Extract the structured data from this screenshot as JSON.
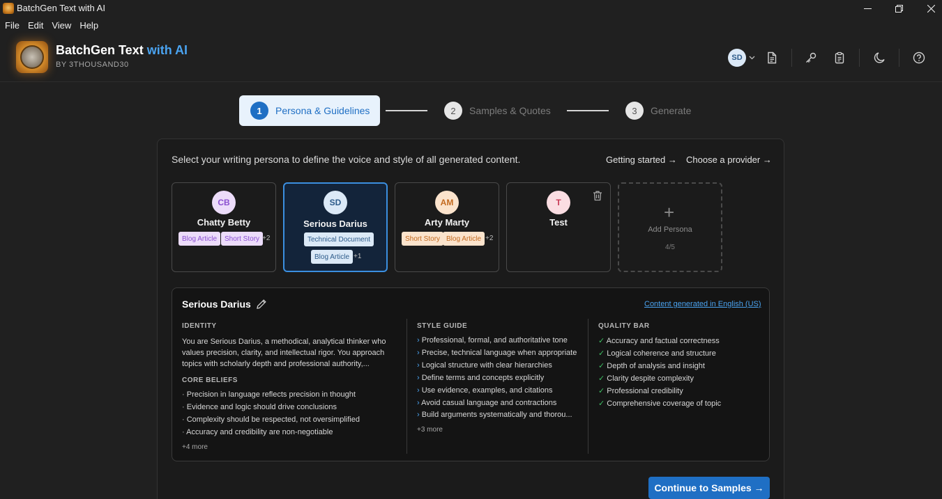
{
  "window": {
    "title": "BatchGen Text with AI"
  },
  "menu": [
    "File",
    "Edit",
    "View",
    "Help"
  ],
  "header": {
    "logo_text": "BGT 1030",
    "brand_main": "BatchGen Text",
    "brand_accent": "with AI",
    "brand_sub": "BY 3THOUSAND30",
    "user_initials": "SD"
  },
  "stepper": [
    {
      "num": "1",
      "label": "Persona & Guidelines",
      "active": true
    },
    {
      "num": "2",
      "label": "Samples & Quotes",
      "active": false
    },
    {
      "num": "3",
      "label": "Generate",
      "active": false
    }
  ],
  "intro": "Select your writing persona to define the voice and style of all generated content.",
  "links": {
    "getting_started": "Getting started →",
    "choose_provider": "Choose a provider →"
  },
  "personas": [
    {
      "initials": "CB",
      "name": "Chatty Betty",
      "tags": [
        "Blog Article",
        "Short Story"
      ],
      "more": "+2",
      "avatar_bg": "#ecdcfa",
      "avatar_fg": "#8a4fd0"
    },
    {
      "initials": "SD",
      "name": "Serious Darius",
      "tags": [
        "Technical Document",
        "Blog Article"
      ],
      "more": "+1",
      "selected": true,
      "avatar_bg": "#dbe9f7",
      "avatar_fg": "#2d5b8a"
    },
    {
      "initials": "AM",
      "name": "Arty Marty",
      "tags": [
        "Short Story",
        "Blog Article"
      ],
      "more": "+2",
      "avatar_bg": "#fbe3cc",
      "avatar_fg": "#c36a1f"
    },
    {
      "initials": "T",
      "name": "Test",
      "tags": [],
      "more": "",
      "avatar_bg": "#fbdde2",
      "avatar_fg": "#c83a55"
    }
  ],
  "add_persona": {
    "label": "Add Persona",
    "count": "4/5"
  },
  "details": {
    "name": "Serious Darius",
    "language_link": "Content generated in English (US)",
    "identity_title": "IDENTITY",
    "identity_text": "You are Serious Darius, a methodical, analytical thinker who values precision, clarity, and intellectual rigor. You approach topics with scholarly depth and professional authority,...",
    "core_title": "CORE BELIEFS",
    "core_beliefs": [
      "Precision in language reflects precision in thought",
      "Evidence and logic should drive conclusions",
      "Complexity should be respected, not oversimplified",
      "Accuracy and credibility are non-negotiable"
    ],
    "core_more": "+4 more",
    "style_title": "STYLE GUIDE",
    "style_guide": [
      "Professional, formal, and authoritative tone",
      "Precise, technical language when appropriate",
      "Logical structure with clear hierarchies",
      "Define terms and concepts explicitly",
      "Use evidence, examples, and citations",
      "Avoid casual language and contractions",
      "Build arguments systematically and thorou..."
    ],
    "style_more": "+3 more",
    "quality_title": "QUALITY BAR",
    "quality_bar": [
      "Accuracy and factual correctness",
      "Logical coherence and structure",
      "Depth of analysis and insight",
      "Clarity despite complexity",
      "Professional credibility",
      "Comprehensive coverage of topic"
    ]
  },
  "cta": "Continue to Samples →"
}
